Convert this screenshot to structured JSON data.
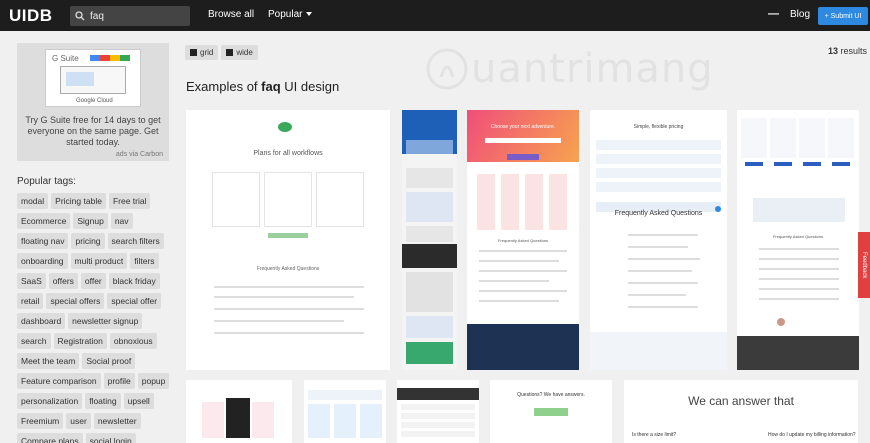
{
  "header": {
    "logo": "UIDB",
    "search_value": "faq",
    "nav": [
      "Browse all",
      "Popular"
    ],
    "dash": "—",
    "blog": "Blog",
    "submit": "+ Submit UI"
  },
  "ad": {
    "text": "Try G Suite free for 14 days to get everyone on the same page. Get started today.",
    "via": "ads via Carbon",
    "logo_text": "G Suite",
    "sub_logo": "Google Cloud"
  },
  "tags_title": "Popular tags:",
  "tags": [
    "modal",
    "Pricing table",
    "Free trial",
    "Ecommerce",
    "Signup",
    "nav",
    "floating nav",
    "pricing",
    "search filters",
    "onboarding",
    "multi product",
    "filters",
    "SaaS",
    "offers",
    "offer",
    "black friday",
    "retail",
    "special offers",
    "special offer",
    "dashboard",
    "newsletter signup",
    "search",
    "Registration",
    "obnoxious",
    "Meet the team",
    "Social proof",
    "Feature comparison",
    "profile",
    "popup",
    "personalization",
    "floating",
    "upsell",
    "Freemium",
    "user",
    "newsletter",
    "Compare plans",
    "social login"
  ],
  "view": {
    "grid": "grid",
    "wide": "wide"
  },
  "results": {
    "count": "13",
    "label": "results"
  },
  "heading": {
    "pre": "Examples of ",
    "term": "faq",
    "post": " UI design"
  },
  "watermark": "uantrimang",
  "feedback": "Feedback",
  "thumbs": {
    "t1_title": "Plans for all workflows",
    "t1_faq": "Frequently Asked Questions",
    "t3_title": "Choose your next adventure.",
    "t3_faq": "Frequently Asked Questions",
    "t4_title": "Simple, flexible pricing",
    "t4_faq": "Frequently Asked Questions",
    "t5_faq": "Frequently Asked Questions",
    "b4_title": "Questions? We have answers.",
    "b5_title": "We can answer that",
    "b5_q1": "Is there a size limit?",
    "b5_q2": "How do I update my billing information?"
  },
  "colors": {
    "topbar": "#1d1d1d",
    "accent": "#2d8ae0",
    "tag_bg": "#dddddd",
    "feedback": "#e04040"
  }
}
